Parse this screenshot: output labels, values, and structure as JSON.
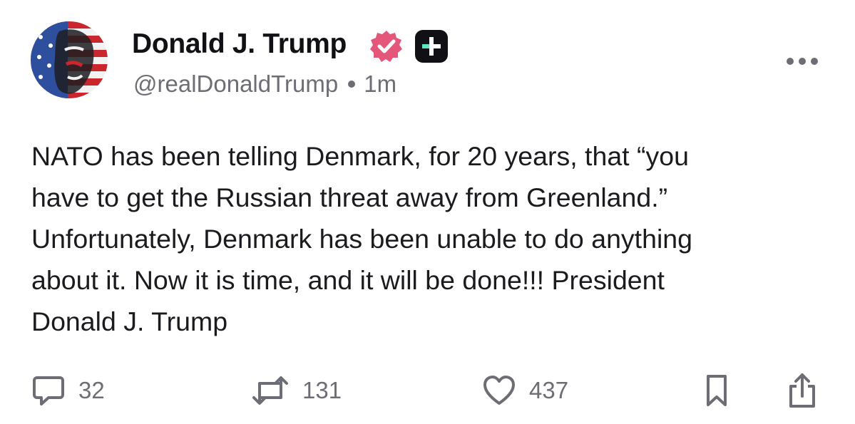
{
  "author": {
    "display_name": "Donald J. Trump",
    "handle": "@realDonaldTrump",
    "time": "1m",
    "verified_icon": "verified-badge-icon",
    "verified_color": "#e4577b",
    "plus_icon": "plus-badge-icon"
  },
  "post": {
    "text": "NATO has been telling Denmark, for 20 years, that “you\nhave to get the Russian threat away from Greenland.”\nUnfortunately, Denmark has been unable to do anything\nabout it. Now it is time, and it will be done!!! President\nDonald J. Trump"
  },
  "actions": {
    "reply": {
      "icon": "comment-icon",
      "count": "32"
    },
    "repost": {
      "icon": "repost-icon",
      "count": "131"
    },
    "like": {
      "icon": "heart-icon",
      "count": "437"
    },
    "bookmark": {
      "icon": "bookmark-icon"
    },
    "share": {
      "icon": "share-icon"
    }
  },
  "colors": {
    "text": "#1b1b1f",
    "muted": "#6d6d76",
    "badge_dark": "#111115",
    "badge_accent": "#5ce5c0"
  }
}
